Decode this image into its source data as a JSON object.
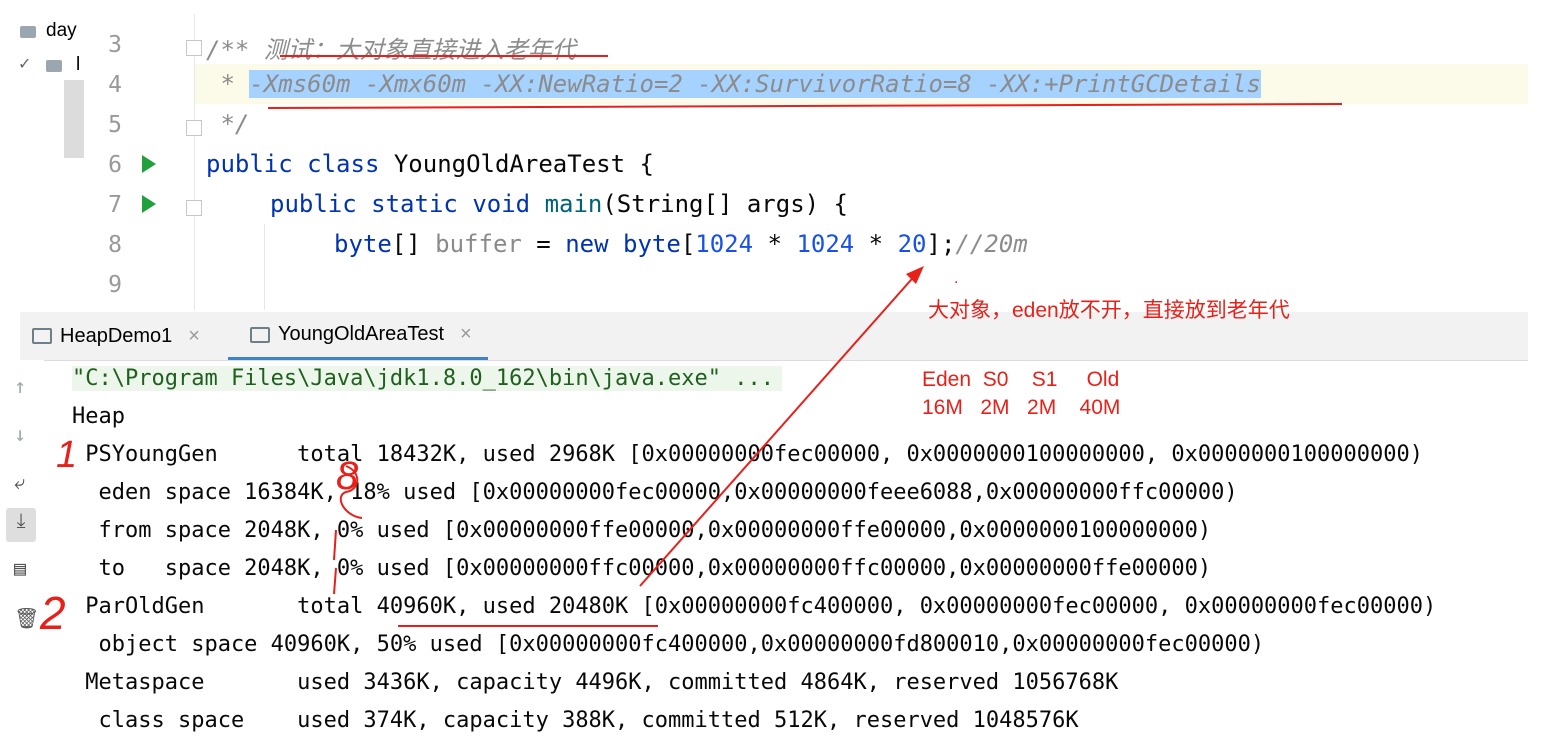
{
  "project_tree": {
    "items": [
      {
        "label": "day",
        "expanded": false
      },
      {
        "label": "l",
        "expanded": true
      }
    ]
  },
  "editor": {
    "lines": [
      {
        "number": "3",
        "text_prefix": "/** ",
        "text_comment": "测试：大对象直接进入老年代"
      },
      {
        "number": "4",
        "text_prefix": " * ",
        "text_selected": "-Xms60m -Xmx60m -XX:NewRatio=2 -XX:SurvivorRatio=8 -XX:+PrintGCDetails"
      },
      {
        "number": "5",
        "text": " */"
      },
      {
        "number": "6",
        "kw1": "public",
        "kw2": "class",
        "rest": " YoungOldAreaTest {"
      },
      {
        "number": "7",
        "kw1": "public",
        "kw2": "static",
        "kw3": "void",
        "method": "main",
        "rest": "(String[] args) {"
      },
      {
        "number": "8",
        "kw_type": "byte",
        "after_type": "[] ",
        "var": "buffer",
        "eq": " = ",
        "kw_new": "new",
        "type2": " byte",
        "bracket": "[",
        "n1": "1024",
        "op1": " * ",
        "n2": "1024",
        "op2": " * ",
        "n3": "20",
        "end": "];",
        "comment": "//20m"
      },
      {
        "number": "9",
        "text": ""
      }
    ]
  },
  "tabs": [
    {
      "label": "HeapDemo1",
      "active": false
    },
    {
      "label": "YoungOldAreaTest",
      "active": true
    }
  ],
  "console": {
    "command": "\"C:\\Program Files\\Java\\jdk1.8.0_162\\bin\\java.exe\" ...",
    "lines": [
      "Heap",
      " PSYoungGen      total 18432K, used 2968K [0x00000000fec00000, 0x0000000100000000, 0x0000000100000000)",
      "  eden space 16384K, 18% used [0x00000000fec00000,0x00000000feee6088,0x00000000ffc00000)",
      "  from space 2048K, 0% used [0x00000000ffe00000,0x00000000ffe00000,0x0000000100000000)",
      "  to   space 2048K, 0% used [0x00000000ffc00000,0x00000000ffc00000,0x00000000ffe00000)",
      " ParOldGen       total 40960K, used 20480K [0x00000000fc400000, 0x00000000fec00000, 0x00000000fec00000)",
      "  object space 40960K, 50% used [0x00000000fc400000,0x00000000fd800010,0x00000000fec00000)",
      " Metaspace       used 3436K, capacity 4496K, committed 4864K, reserved 1056768K",
      "  class space    used 374K, capacity 388K, committed 512K, reserved 1048576K"
    ]
  },
  "annotations": {
    "big_object_note": "大对象，eden放不开，直接放到老年代",
    "dot": ".",
    "regions_header": "Eden  S0    S1     Old",
    "regions_sizes": "16M   2M   2M    40M",
    "mark_1": "1",
    "mark_2": "2",
    "mark_8": "8",
    "color": "#e8201a"
  }
}
